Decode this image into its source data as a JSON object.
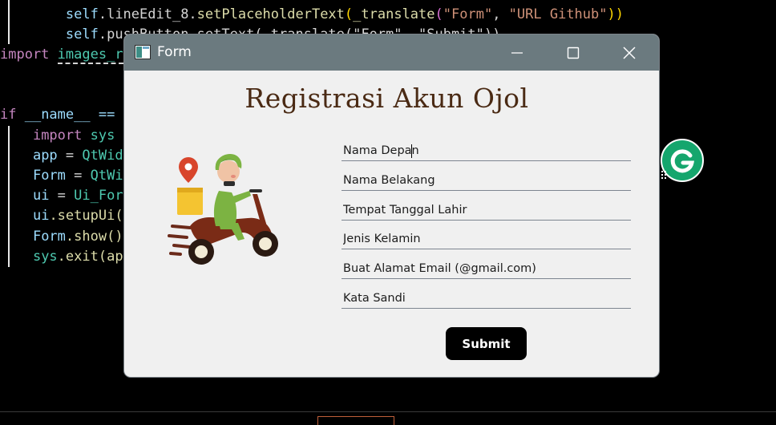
{
  "editor": {
    "line1": {
      "indent": "        ",
      "self": "self",
      "rest1": ".lineEdit_8.",
      "fn": "setPlaceholderText",
      "open": "(",
      "fn2": "_translate",
      "open2": "(",
      "str1": "\"Form\"",
      "comma": ", ",
      "str2": "\"URL Github\"",
      "close": "))"
    },
    "line2": {
      "indent": "        ",
      "self": "self",
      "rest": ".pushButton.setText(_translate(\"Form\", \"Submit\"))"
    },
    "line3": {
      "kw": "import",
      "space": " ",
      "mod": "images_r"
    },
    "line5": {
      "kw": "if",
      "rest": " __name__ == "
    },
    "line6": {
      "indent": "    ",
      "kw": "import",
      "rest": " sys"
    },
    "line7": {
      "indent": "    ",
      "var": "app",
      "eq": " = ",
      "cls": "QtWid"
    },
    "line8": {
      "indent": "    ",
      "var": "Form",
      "eq": " = ",
      "cls": "QtWi"
    },
    "line9": {
      "indent": "    ",
      "var": "ui",
      "eq": " = ",
      "cls": "Ui_For"
    },
    "line10": {
      "indent": "    ",
      "var": "ui",
      "rest": ".setupUi("
    },
    "line11": {
      "indent": "    ",
      "var": "Form",
      "rest": ".show()"
    },
    "line12": {
      "indent": "    ",
      "var": "sys",
      "rest": ".exit(ap"
    }
  },
  "window": {
    "title": "Form",
    "controls": {
      "minimize": "minimize",
      "maximize": "maximize",
      "close": "close"
    }
  },
  "form": {
    "heading": "Registrasi Akun Ojol",
    "fields": [
      {
        "placeholder": "Nama Depan",
        "value": ""
      },
      {
        "placeholder": "Nama Belakang",
        "value": ""
      },
      {
        "placeholder": "Tempat Tanggal Lahir",
        "value": ""
      },
      {
        "placeholder": "Jenis Kelamin",
        "value": ""
      },
      {
        "placeholder": "Buat Alamat Email (@gmail.com)",
        "value": ""
      },
      {
        "placeholder": "Kata Sandi",
        "value": ""
      }
    ],
    "submit_label": "Submit"
  },
  "colors": {
    "titlebar": "#6b7a7f",
    "window_bg": "#f0f0f0",
    "heading": "#4a2a14",
    "submit_bg": "#000000",
    "grammarly": "#15a66d"
  },
  "icons": {
    "app": "app-window-icon",
    "scooter": "delivery-scooter-illustration",
    "grammarly": "grammarly-icon"
  }
}
